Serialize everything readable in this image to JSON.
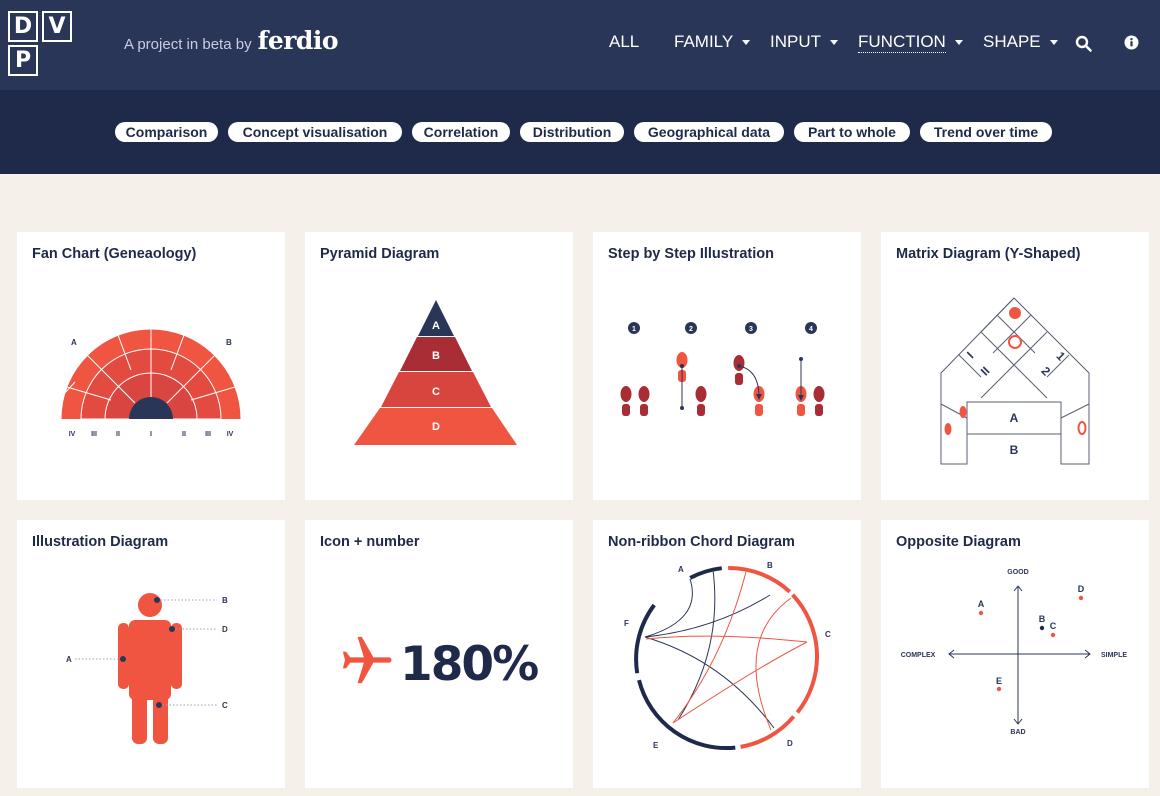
{
  "logo": {
    "letters": [
      "D",
      "V",
      "P"
    ]
  },
  "tagline": {
    "text": "A project in beta by",
    "brand": "ferdio"
  },
  "nav": {
    "all": "ALL",
    "family": "FAMILY",
    "input": "INPUT",
    "function": "FUNCTION",
    "shape": "SHAPE",
    "search_icon": "search-icon",
    "info_icon": "info-icon"
  },
  "filters": [
    "Comparison",
    "Concept visualisation",
    "Correlation",
    "Distribution",
    "Geographical data",
    "Part to whole",
    "Trend over time"
  ],
  "cards": [
    {
      "title": "Fan Chart (Geneaology)",
      "labels": {
        "a": "A",
        "b": "B",
        "ticks": [
          "IV",
          "III",
          "II",
          "I",
          "II",
          "III",
          "IV"
        ]
      }
    },
    {
      "title": "Pyramid Diagram",
      "labels": [
        "A",
        "B",
        "C",
        "D"
      ]
    },
    {
      "title": "Step by Step Illustration",
      "labels": [
        "1",
        "2",
        "3",
        "4"
      ]
    },
    {
      "title": "Matrix Diagram (Y-Shaped)",
      "labels": {
        "i": "I",
        "ii": "II",
        "one": "1",
        "two": "2",
        "a": "A",
        "b": "B"
      }
    },
    {
      "title": "Illustration Diagram",
      "labels": {
        "a": "A",
        "b": "B",
        "c": "C",
        "d": "D"
      }
    },
    {
      "title": "Icon + number",
      "value": "180%"
    },
    {
      "title": "Non-ribbon Chord Diagram",
      "labels": {
        "a": "A",
        "b": "B",
        "c": "C",
        "d": "D",
        "e": "E",
        "f": "F"
      }
    },
    {
      "title": "Opposite Diagram",
      "labels": {
        "good": "GOOD",
        "bad": "BAD",
        "complex": "COMPLEX",
        "simple": "SIMPLE",
        "a": "A",
        "b": "B",
        "c": "C",
        "d": "D",
        "e": "E"
      }
    }
  ],
  "colors": {
    "navy": "#2a3657",
    "navy_dark": "#1f2a4a",
    "red": "#f05542",
    "red_dark": "#c43a3a",
    "background": "#f5f0ea"
  }
}
